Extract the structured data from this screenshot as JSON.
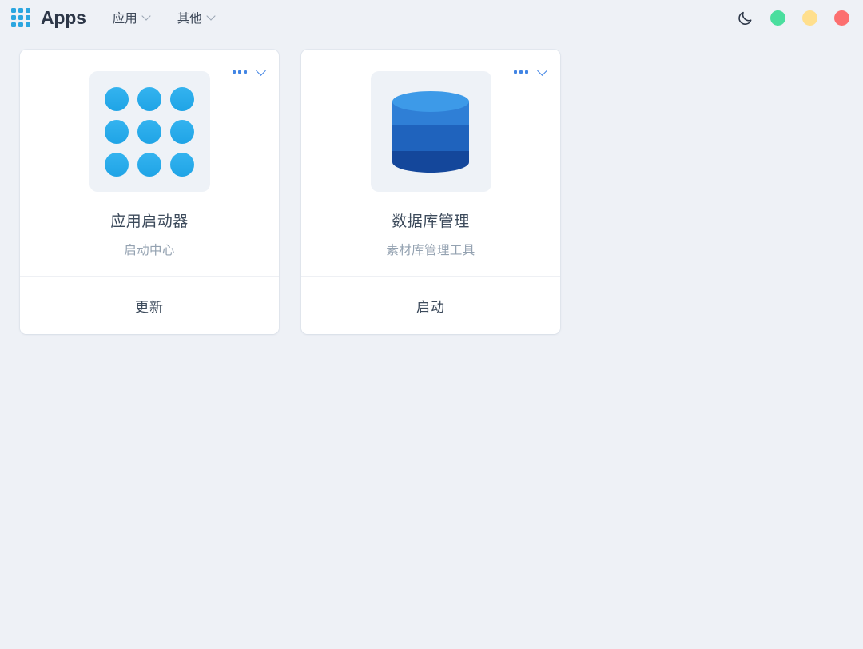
{
  "header": {
    "logo_icon": "app-grid-icon",
    "brand_title": "Apps",
    "nav": [
      {
        "label": "应用",
        "caret_icon": "chevron-down-icon"
      },
      {
        "label": "其他",
        "caret_icon": "chevron-down-icon"
      }
    ],
    "theme_toggle_icon": "moon-icon",
    "window_controls": [
      {
        "name": "minimize-dot",
        "color": "#4ade9e"
      },
      {
        "name": "maximize-dot",
        "color": "#ffdf8d"
      },
      {
        "name": "close-dot",
        "color": "#fc6f6f"
      }
    ]
  },
  "cards": [
    {
      "icon": "app-grid-icon",
      "title": "应用启动器",
      "subtitle": "启动中心",
      "action_label": "更新",
      "more_icon": "ellipsis-icon",
      "expand_icon": "chevron-down-icon"
    },
    {
      "icon": "database-icon",
      "title": "数据库管理",
      "subtitle": "素材库管理工具",
      "action_label": "启动",
      "more_icon": "ellipsis-icon",
      "expand_icon": "chevron-down-icon"
    }
  ],
  "colors": {
    "page_background": "#eef1f6",
    "card_background": "#ffffff",
    "accent_blue": "#2ba6e0",
    "action_blue": "#4285e4",
    "title_text": "#3c4a5b",
    "subtitle_text": "#94a2b1",
    "icon_tile_background": "#eef2f7",
    "db_top": "#3d9ae8",
    "db_band_1": "#2f7fd6",
    "db_band_2": "#1f63bd",
    "db_band_3": "#14479b"
  }
}
